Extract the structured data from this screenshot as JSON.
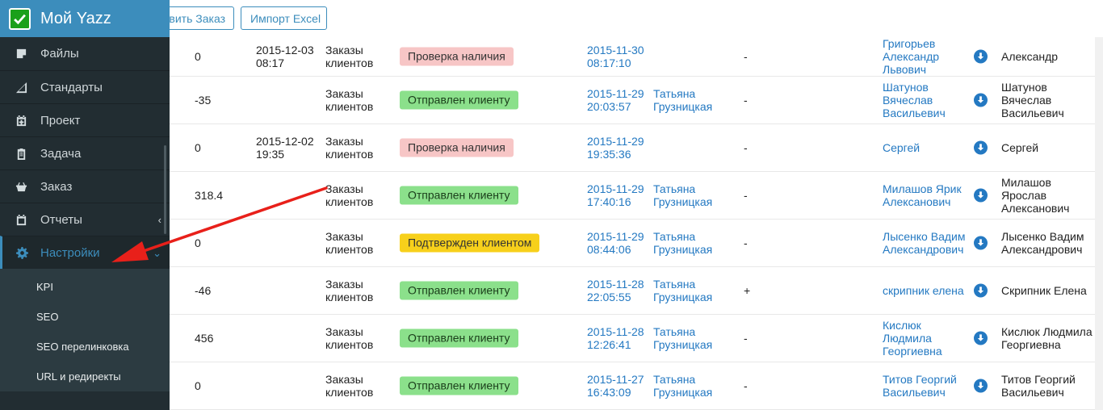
{
  "brand": {
    "title": "Мой Yazz"
  },
  "sidebar": {
    "items": [
      {
        "label": "Файлы",
        "icon": "file-icon"
      },
      {
        "label": "Стандарты",
        "icon": "triangle-ruler-icon"
      },
      {
        "label": "Проект",
        "icon": "calendar-plus-icon"
      },
      {
        "label": "Задача",
        "icon": "clipboard-icon"
      },
      {
        "label": "Заказ",
        "icon": "basket-icon"
      },
      {
        "label": "Отчеты",
        "icon": "calendar-icon",
        "chevron": "‹"
      },
      {
        "label": "Настройки",
        "icon": "gear-icon",
        "chevron": "⌄"
      }
    ],
    "submenu": [
      "KPI",
      "SEO",
      "SEO перелинковка",
      "URL и редиректы"
    ]
  },
  "toolbar": {
    "add_label": "вить Заказ",
    "import_label": "Импорт Excel"
  },
  "colors": {
    "accent": "#3c8dbc",
    "sidebar_bg": "#222d32",
    "link": "#2479c2",
    "arrow": "#e8201a"
  },
  "table": {
    "rows": [
      {
        "num": "0",
        "date": "2015-12-03 08:17",
        "type": "Заказы клиентов",
        "status": "Проверка наличия",
        "status_color": "red",
        "created": "2015-11-30 08:17:10",
        "manager": "",
        "flag": "-",
        "client": "Григорьев Александр Львович",
        "name": "Александр"
      },
      {
        "num": "-35",
        "date": "",
        "type": "Заказы клиентов",
        "status": "Отправлен клиенту",
        "status_color": "green",
        "created": "2015-11-29 20:03:57",
        "manager": "Татьяна Грузницкая",
        "flag": "-",
        "client": "Шатунов Вячеслав Васильевич",
        "name": "Шатунов Вячеслав Васильевич"
      },
      {
        "num": "0",
        "date": "2015-12-02 19:35",
        "type": "Заказы клиентов",
        "status": "Проверка наличия",
        "status_color": "red",
        "created": "2015-11-29 19:35:36",
        "manager": "",
        "flag": "-",
        "client": "Сергей",
        "name": "Сергей"
      },
      {
        "num": "318.4",
        "date": "",
        "type": "Заказы клиентов",
        "status": "Отправлен клиенту",
        "status_color": "green",
        "created": "2015-11-29 17:40:16",
        "manager": "Татьяна Грузницкая",
        "flag": "-",
        "client": "Милашов Ярик Алексанович",
        "name": "Милашов Ярослав Алексанович"
      },
      {
        "num": "0",
        "date": "",
        "type": "Заказы клиентов",
        "status": "Подтвержден клиентом",
        "status_color": "yellow",
        "created": "2015-11-29 08:44:06",
        "manager": "Татьяна Грузницкая",
        "flag": "-",
        "client": "Лысенко Вадим Александрович",
        "name": "Лысенко Вадим Александрович"
      },
      {
        "num": "-46",
        "date": "",
        "type": "Заказы клиентов",
        "status": "Отправлен клиенту",
        "status_color": "green",
        "created": "2015-11-28 22:05:55",
        "manager": "Татьяна Грузницкая",
        "flag": "+",
        "client": "скрипник елена",
        "name": "Скрипник Елена"
      },
      {
        "num": "456",
        "date": "",
        "type": "Заказы клиентов",
        "status": "Отправлен клиенту",
        "status_color": "green",
        "created": "2015-11-28 12:26:41",
        "manager": "Татьяна Грузницкая",
        "flag": "-",
        "client": "Кислюк Людмила Георгиевна",
        "name": "Кислюк Людмила Георгиевна"
      },
      {
        "num": "0",
        "date": "",
        "type": "Заказы клиентов",
        "status": "Отправлен клиенту",
        "status_color": "green",
        "created": "2015-11-27 16:43:09",
        "manager": "Татьяна Грузницкая",
        "flag": "-",
        "client": "Титов Георгий Васильевич",
        "name": "Титов Георгий Васильевич"
      }
    ]
  }
}
